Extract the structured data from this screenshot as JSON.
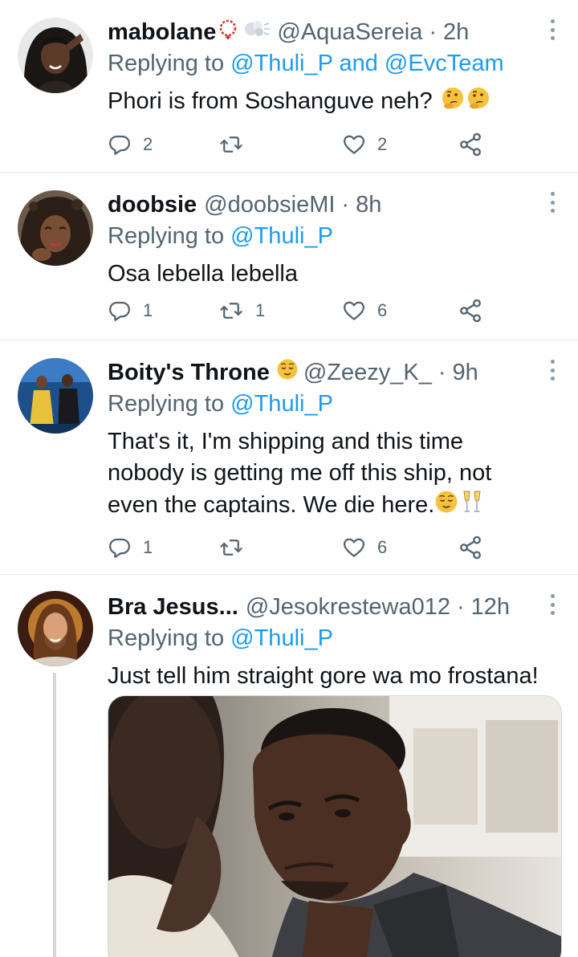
{
  "tweets": [
    {
      "name": "mabolane",
      "name_emojis": [
        "rosary-emoji",
        "dashing-away-emoji"
      ],
      "handle": "@AquaSereia",
      "dot": "·",
      "time": "2h",
      "replying_prefix": "Replying to",
      "mentions": [
        "@Thuli_P",
        "@EvcTeam"
      ],
      "mention_joiner": "and",
      "body_lines": [
        "Phori is from Soshanguve neh?"
      ],
      "body_emojis": [
        "thinking-face-emoji",
        "thinking-face-emoji"
      ],
      "reply_count": "2",
      "retweet_count": "",
      "like_count": "2"
    },
    {
      "name": "doobsie",
      "handle": "@doobsieMI",
      "dot": "·",
      "time": "8h",
      "replying_prefix": "Replying to",
      "mentions": [
        "@Thuli_P"
      ],
      "body_lines": [
        "Osa lebella lebella"
      ],
      "reply_count": "1",
      "retweet_count": "1",
      "like_count": "6"
    },
    {
      "name": "Boity's Throne",
      "name_emojis": [
        "relieved-face-emoji"
      ],
      "handle": "@Zeezy_K_",
      "dot": "·",
      "time": "9h",
      "replying_prefix": "Replying to",
      "mentions": [
        "@Thuli_P"
      ],
      "body_lines": [
        "That's it, I'm shipping and this time",
        "nobody is getting me off this ship, not",
        "even the captains. We die here."
      ],
      "body_emojis": [
        "relieved-face-emoji",
        "clinking-glasses-emoji"
      ],
      "reply_count": "1",
      "retweet_count": "",
      "like_count": "6"
    },
    {
      "name": "Bra Jesus...",
      "handle": "@Jesokrestewa012",
      "dot": "·",
      "time": "12h",
      "replying_prefix": "Replying to",
      "mentions": [
        "@Thuli_P"
      ],
      "body_lines": [
        "Just tell him straight gore wa mo frostana!"
      ],
      "media": "photo-two-men-close-up"
    }
  ],
  "icons": {
    "reply": "reply-icon",
    "retweet": "retweet-icon",
    "like": "heart-icon",
    "share": "share-icon",
    "more": "more-icon"
  },
  "colors": {
    "link": "#1d9bf0",
    "secondary_text": "#536471",
    "divider": "#e3e6e9"
  }
}
